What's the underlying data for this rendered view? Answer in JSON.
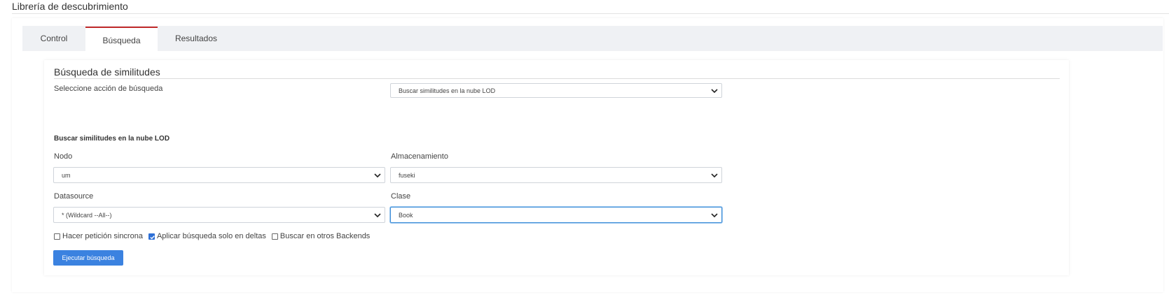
{
  "page": {
    "title": "Librería de descubrimiento"
  },
  "tabs": [
    {
      "label": "Control",
      "active": false
    },
    {
      "label": "Búsqueda",
      "active": true
    },
    {
      "label": "Resultados",
      "active": false
    }
  ],
  "search": {
    "section_title": "Búsqueda de similitudes",
    "action_label": "Seleccione acción de búsqueda",
    "action_value": "Buscar similitudes en la nube LOD",
    "subsection_title": "Buscar similitudes en la nube LOD",
    "node_label": "Nodo",
    "node_value": "um",
    "storage_label": "Almacenamiento",
    "storage_value": "fuseki",
    "datasource_label": "Datasource",
    "datasource_value": "* (Wildcard --All--)",
    "class_label": "Clase",
    "class_value": "Book"
  },
  "options": {
    "sync_label": "Hacer petición sincrona",
    "sync_checked": false,
    "deltas_label": "Aplicar búsqueda solo en deltas",
    "deltas_checked": true,
    "backends_label": "Buscar en otros Backends",
    "backends_checked": false
  },
  "actions": {
    "run_label": "Ejecutar búsqueda"
  },
  "colors": {
    "accent": "#3b82e0",
    "active_tab": "#c12a2a",
    "tabbar_bg": "#eff1f4",
    "focus": "#3f8fd8"
  },
  "icons": {
    "select_arrow": "chevron-down-icon",
    "check": "checkmark-icon"
  }
}
